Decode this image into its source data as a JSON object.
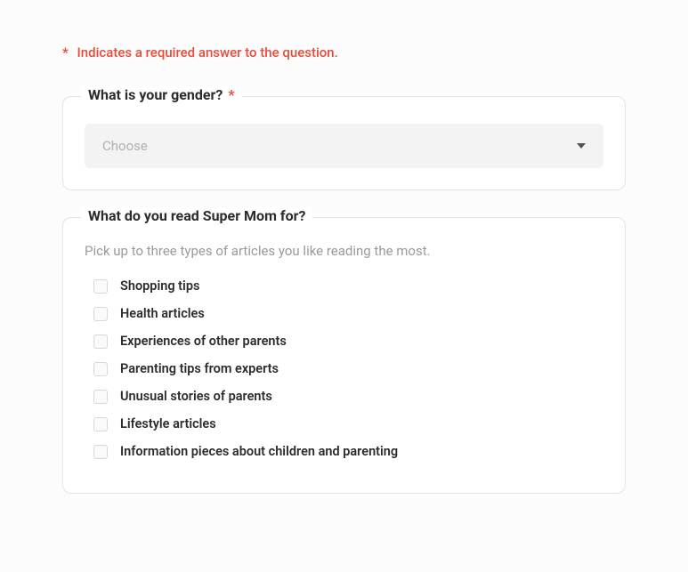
{
  "requiredNote": {
    "asterisk": "*",
    "text": "Indicates a required answer to the question."
  },
  "questions": [
    {
      "legend": "What is your gender?",
      "required": true,
      "type": "select",
      "placeholder": "Choose"
    },
    {
      "legend": "What do you read Super Mom for?",
      "required": false,
      "type": "checkbox",
      "helper": "Pick up to three types of articles you like reading the most.",
      "options": [
        "Shopping tips",
        "Health articles",
        "Experiences of other parents",
        "Parenting tips from experts",
        "Unusual stories of parents",
        "Lifestyle articles",
        "Information pieces about children and parenting"
      ]
    }
  ]
}
